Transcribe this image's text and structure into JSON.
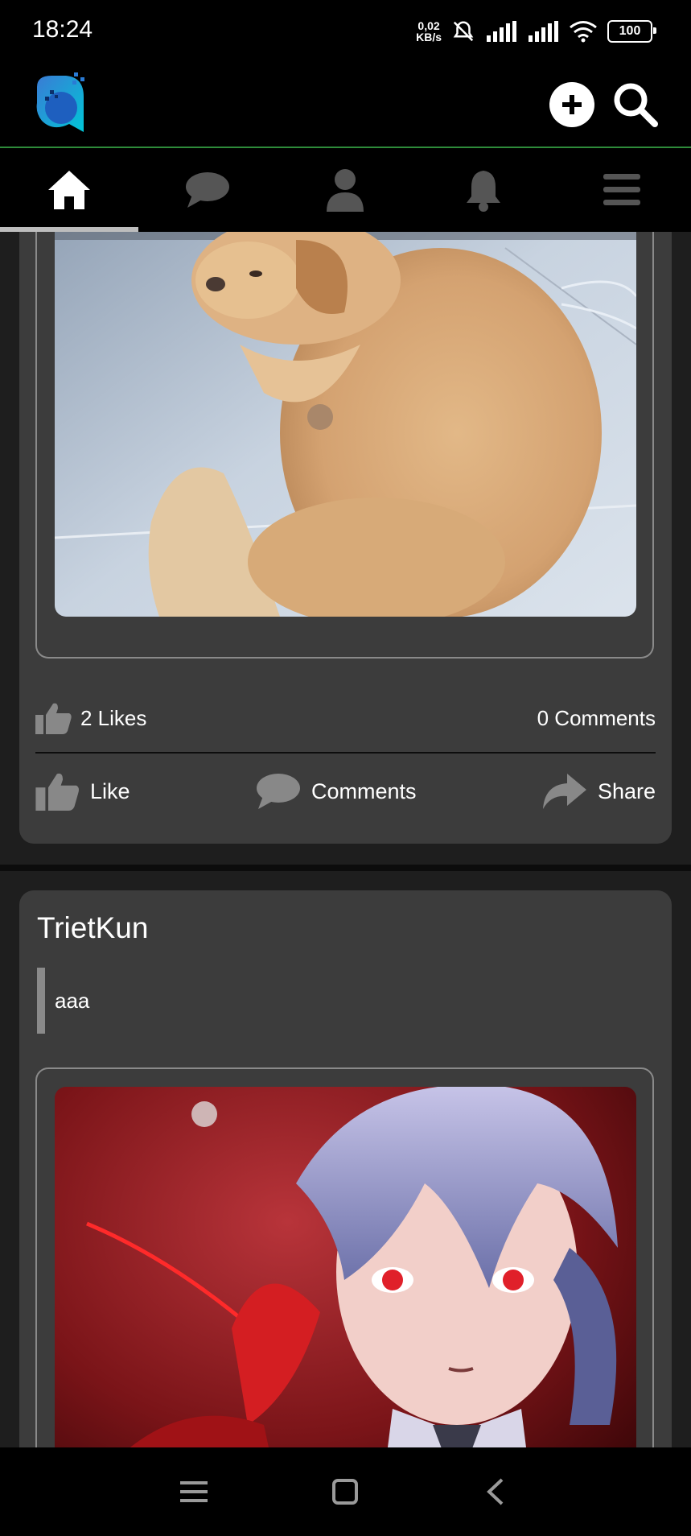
{
  "status_bar": {
    "time": "18:24",
    "net_speed_value": "0,02",
    "net_speed_unit": "KB/s",
    "battery": "100",
    "icons": [
      "mute-bell-icon",
      "signal-icon",
      "signal-icon",
      "wifi-icon",
      "battery-icon"
    ]
  },
  "header": {
    "logo": "app-logo",
    "add_icon": "plus-circle-icon",
    "search_icon": "search-icon"
  },
  "tabs": [
    {
      "name": "home",
      "icon": "home-icon",
      "active": true
    },
    {
      "name": "messages",
      "icon": "chat-icon",
      "active": false
    },
    {
      "name": "profile",
      "icon": "user-icon",
      "active": false
    },
    {
      "name": "notifications",
      "icon": "bell-icon",
      "active": false
    },
    {
      "name": "menu",
      "icon": "hamburger-icon",
      "active": false
    }
  ],
  "posts": [
    {
      "image": "golden retriever puppy lying on tiled floor",
      "likes_text": "2 Likes",
      "comments_text": "0 Comments",
      "actions": {
        "like": "Like",
        "comments": "Comments",
        "share": "Share"
      }
    },
    {
      "author": "TrietKun",
      "text": "aaa",
      "image": "anime character with silver hair and red eyes on red background"
    }
  ],
  "nav": {
    "menu_icon": "recents-icon",
    "home_icon": "home-square-icon",
    "back_icon": "back-icon"
  },
  "colors": {
    "header_divider": "#2e8b3a",
    "card_bg": "#3c3c3c",
    "page_bg": "#1e1e1e"
  }
}
